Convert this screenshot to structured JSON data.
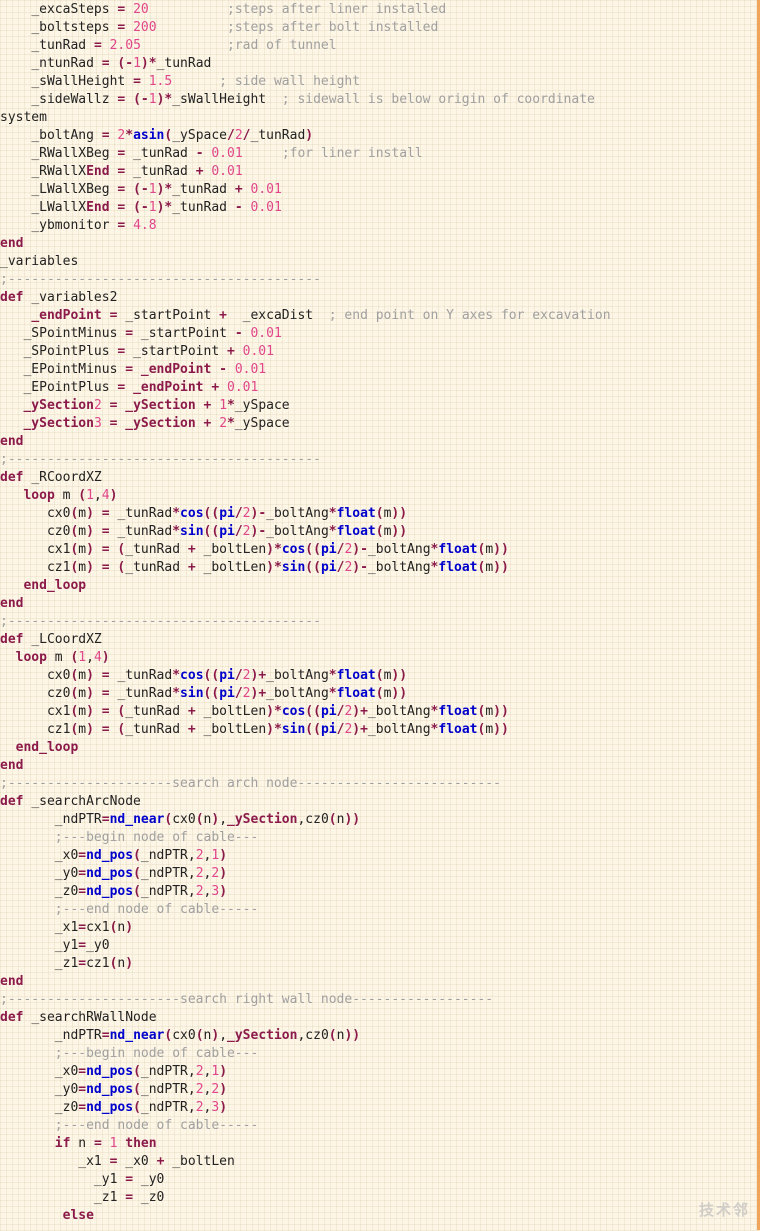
{
  "code_lines": [
    "    _excaSteps = 20          ;steps after liner installed",
    "    _boltsteps = 200         ;steps after bolt installed",
    "    _tunRad = 2.05           ;rad of tunnel",
    "    _ntunRad = (-1)*_tunRad",
    "    _sWallHeight = 1.5      ; side wall height",
    "    _sideWallz = (-1)*_sWallHeight  ; sidewall is below origin of coordinate",
    "system",
    "    _boltAng = 2*asin(_ySpace/2/_tunRad)",
    "    _RWallXBeg = _tunRad - 0.01     ;for liner install",
    "    _RWallXEnd = _tunRad + 0.01",
    "    _LWallXBeg = (-1)*_tunRad + 0.01",
    "    _LWallXEnd = (-1)*_tunRad - 0.01",
    "    _ybmonitor = 4.8",
    "end",
    "_variables",
    ";----------------------------------------",
    "def _variables2",
    "    _endPoint = _startPoint +  _excaDist  ; end point on Y axes for excavation",
    "   _SPointMinus = _startPoint - 0.01",
    "   _SPointPlus = _startPoint + 0.01",
    "   _EPointMinus = _endPoint - 0.01",
    "   _EPointPlus = _endPoint + 0.01",
    "   _ySection2 = _ySection + 1*_ySpace",
    "   _ySection3 = _ySection + 2*_ySpace",
    "end",
    ";----------------------------------------",
    "def _RCoordXZ",
    "   loop m (1,4)",
    "      cx0(m) = _tunRad*cos((pi/2)-_boltAng*float(m))",
    "      cz0(m) = _tunRad*sin((pi/2)-_boltAng*float(m))",
    "      cx1(m) = (_tunRad + _boltLen)*cos((pi/2)-_boltAng*float(m))",
    "      cz1(m) = (_tunRad + _boltLen)*sin((pi/2)-_boltAng*float(m))",
    "   end_loop",
    "end",
    ";----------------------------------------",
    "def _LCoordXZ",
    "  loop m (1,4)",
    "      cx0(m) = _tunRad*cos((pi/2)+_boltAng*float(m))",
    "      cz0(m) = _tunRad*sin((pi/2)+_boltAng*float(m))",
    "      cx1(m) = (_tunRad + _boltLen)*cos((pi/2)+_boltAng*float(m))",
    "      cz1(m) = (_tunRad + _boltLen)*sin((pi/2)+_boltAng*float(m))",
    "  end_loop",
    "end",
    ";---------------------search arch node--------------------------",
    "def _searchArcNode",
    "       _ndPTR=nd_near(cx0(n),_ySection,cz0(n))",
    "       ;---begin node of cable---",
    "       _x0=nd_pos(_ndPTR,2,1)",
    "       _y0=nd_pos(_ndPTR,2,2)",
    "       _z0=nd_pos(_ndPTR,2,3)",
    "       ;---end node of cable-----",
    "       _x1=cx1(n)",
    "       _y1=_y0",
    "       _z1=cz1(n)",
    "end",
    ";----------------------search right wall node------------------",
    "def _searchRWallNode",
    "       _ndPTR=nd_near(cx0(n),_ySection,cz0(n))",
    "       ;---begin node of cable---",
    "       _x0=nd_pos(_ndPTR,2,1)",
    "       _y0=nd_pos(_ndPTR,2,2)",
    "       _z0=nd_pos(_ndPTR,2,3)",
    "       ;---end node of cable-----",
    "       if n = 1 then",
    "          _x1 = _x0 + _boltLen",
    "            _y1 = _y0",
    "            _z1 = _z0",
    "        else"
  ],
  "watermark": "技术邻",
  "colors": {
    "background": "#fdf6e6",
    "border": "#f0a55a",
    "keyword": "#1a1aa6",
    "builtin": "#0000cc",
    "number": "#e0468a",
    "comment": "#a0a0a0"
  }
}
